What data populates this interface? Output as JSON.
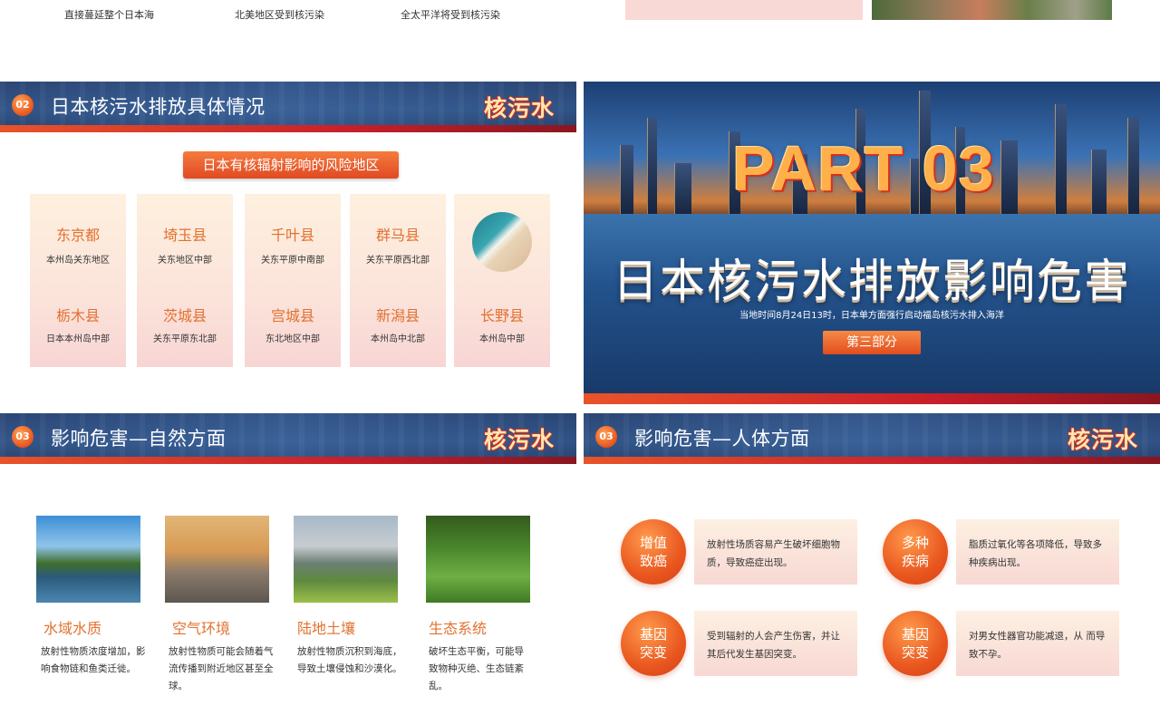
{
  "top_captions": [
    "直接蔓延整个日本海",
    "北美地区受到核污染",
    "全太平洋将受到核污染"
  ],
  "slide02": {
    "num": "02",
    "title": "日本核污水排放具体情况",
    "brand": "核污水",
    "pill": "日本有核辐射影响的风险地区",
    "cards": [
      {
        "n1": "东京都",
        "d1": "本州岛关东地区",
        "n2": "栃木县",
        "d2": "日本本州岛中部"
      },
      {
        "n1": "埼玉县",
        "d1": "关东地区中部",
        "n2": "茨城县",
        "d2": "关东平原东北部"
      },
      {
        "n1": "千叶县",
        "d1": "关东平原中南部",
        "n2": "宫城县",
        "d2": "东北地区中部"
      },
      {
        "n1": "群马县",
        "d1": "关东平原西北部",
        "n2": "新潟县",
        "d2": "本州岛中北部"
      },
      {
        "n2": "长野县",
        "d2": "本州岛中部"
      }
    ]
  },
  "part03": {
    "big": "PART 03",
    "title": "日本核污水排放影响危害",
    "sub": "当地时间8月24日13时，日本单方面强行启动福岛核污水排入海洋",
    "tag": "第三部分"
  },
  "slide03a": {
    "num": "03",
    "title": "影响危害—自然方面",
    "brand": "核污水",
    "items": [
      {
        "title": "水域水质",
        "text": "放射性物质浓度增加，影响食物链和鱼类迁徙。"
      },
      {
        "title": "空气环境",
        "text": "放射性物质可能会随着气流传播到附近地区甚至全球。"
      },
      {
        "title": "陆地土壤",
        "text": "放射性物质沉积到海底，导致土壤侵蚀和沙漠化。"
      },
      {
        "title": "生态系统",
        "text": "破坏生态平衡，可能导致物种灭绝、生态链紊乱。"
      }
    ]
  },
  "slide03b": {
    "num": "03",
    "title": "影响危害—人体方面",
    "brand": "核污水",
    "items": [
      {
        "circle": "增值\n致癌",
        "text": "放射性场质容易产生破坏细胞物质，导致癌症出现。"
      },
      {
        "circle": "多种\n疾病",
        "text": "脂质过氧化等各项降低，导致多种疾病出现。"
      },
      {
        "circle": "基因\n突变",
        "text": "受到辐射的人会产生伤害，并让其后代发生基因突变。"
      },
      {
        "circle": "基因\n突变",
        "text": "对男女性器官功能减退，从 而导致不孕。"
      }
    ]
  }
}
